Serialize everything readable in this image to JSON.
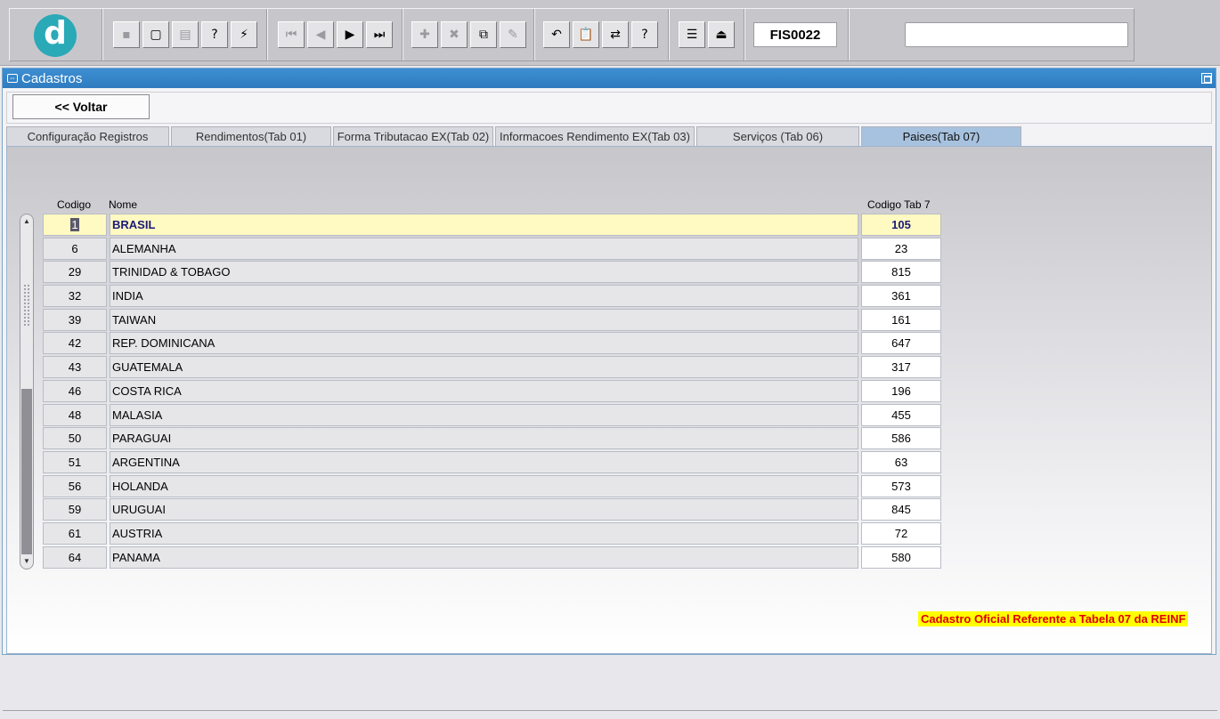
{
  "toolbar": {
    "logo_letter": "d",
    "buttons": [
      {
        "icon": "save-icon",
        "glyph": "▪",
        "enabled": false
      },
      {
        "icon": "window-icon",
        "glyph": "▢",
        "enabled": true
      },
      {
        "icon": "print-icon",
        "glyph": "▤",
        "enabled": false
      },
      {
        "icon": "query-help-icon",
        "glyph": "?",
        "enabled": true
      },
      {
        "icon": "execute-query-icon",
        "glyph": "⚡",
        "enabled": true
      },
      {
        "icon": "first-record-icon",
        "glyph": "⏮",
        "enabled": false
      },
      {
        "icon": "prev-record-icon",
        "glyph": "◀",
        "enabled": false
      },
      {
        "icon": "next-record-icon",
        "glyph": "▶",
        "enabled": true
      },
      {
        "icon": "last-record-icon",
        "glyph": "⏭",
        "enabled": true
      },
      {
        "icon": "insert-record-icon",
        "glyph": "✚",
        "enabled": false
      },
      {
        "icon": "delete-record-icon",
        "glyph": "✖",
        "enabled": false
      },
      {
        "icon": "duplicate-record-icon",
        "glyph": "⧉",
        "enabled": true
      },
      {
        "icon": "edit-icon",
        "glyph": "✎",
        "enabled": false
      },
      {
        "icon": "undo-icon",
        "glyph": "↶",
        "enabled": true
      },
      {
        "icon": "clipboard-icon",
        "glyph": "📋",
        "enabled": true
      },
      {
        "icon": "transfer-icon",
        "glyph": "⇄",
        "enabled": true
      },
      {
        "icon": "help-icon",
        "glyph": "?",
        "enabled": true
      },
      {
        "icon": "menu-icon",
        "glyph": "☰",
        "enabled": true
      },
      {
        "icon": "exit-icon",
        "glyph": "⏏",
        "enabled": true
      }
    ],
    "form_code": "FIS0022",
    "search_value": ""
  },
  "window": {
    "title": "Cadastros",
    "back_button": "<< Voltar"
  },
  "tabs": [
    {
      "label": "Configuração Registros",
      "selected": false
    },
    {
      "label": "Rendimentos(Tab 01)",
      "selected": false
    },
    {
      "label": "Forma Tributacao EX(Tab 02)",
      "selected": false
    },
    {
      "label": "Informacoes Rendimento EX(Tab 03)",
      "selected": false
    },
    {
      "label": "Serviços (Tab 06)",
      "selected": false
    },
    {
      "label": "Paises(Tab 07)",
      "selected": true
    }
  ],
  "table": {
    "headers": {
      "codigo": "Codigo",
      "nome": "Nome",
      "codigo_tab7": "Codigo Tab 7"
    },
    "rows": [
      {
        "codigo": "1",
        "nome": "BRASIL",
        "codigo_tab7": "105",
        "current": true
      },
      {
        "codigo": "6",
        "nome": "ALEMANHA",
        "codigo_tab7": "23"
      },
      {
        "codigo": "29",
        "nome": "TRINIDAD & TOBAGO",
        "codigo_tab7": "815"
      },
      {
        "codigo": "32",
        "nome": "INDIA",
        "codigo_tab7": "361"
      },
      {
        "codigo": "39",
        "nome": "TAIWAN",
        "codigo_tab7": "161"
      },
      {
        "codigo": "42",
        "nome": "REP. DOMINICANA",
        "codigo_tab7": "647"
      },
      {
        "codigo": "43",
        "nome": "GUATEMALA",
        "codigo_tab7": "317"
      },
      {
        "codigo": "46",
        "nome": "COSTA RICA",
        "codigo_tab7": "196"
      },
      {
        "codigo": "48",
        "nome": "MALASIA",
        "codigo_tab7": "455"
      },
      {
        "codigo": "50",
        "nome": "PARAGUAI",
        "codigo_tab7": "586"
      },
      {
        "codigo": "51",
        "nome": "ARGENTINA",
        "codigo_tab7": "63"
      },
      {
        "codigo": "56",
        "nome": "HOLANDA",
        "codigo_tab7": "573"
      },
      {
        "codigo": "59",
        "nome": "URUGUAI",
        "codigo_tab7": "845"
      },
      {
        "codigo": "61",
        "nome": "AUSTRIA",
        "codigo_tab7": "72"
      },
      {
        "codigo": "64",
        "nome": "PANAMA",
        "codigo_tab7": "580"
      }
    ]
  },
  "notice": "Cadastro Oficial Referente a Tabela 07 da REINF",
  "colors": {
    "title_bar": "#3d8fd2",
    "selected_tab": "#a7c2df",
    "current_row": "#fff9c2",
    "notice_bg": "#ffff00",
    "notice_text": "#e00000"
  }
}
